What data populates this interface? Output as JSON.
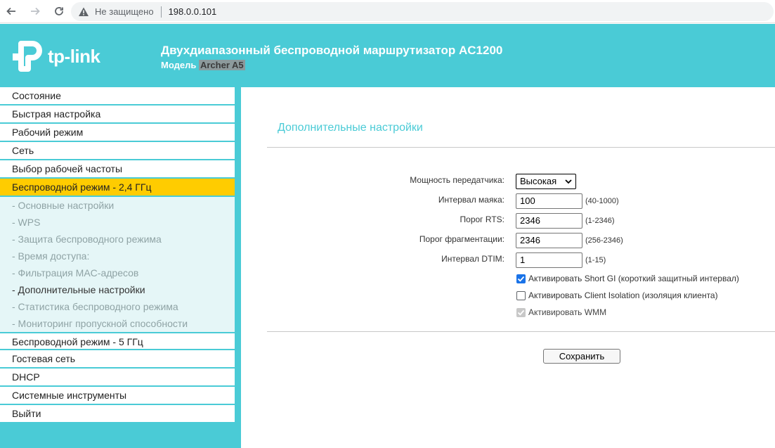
{
  "browser": {
    "security_label": "Не защищено",
    "url": "198.0.0.101"
  },
  "header": {
    "logo_text": "tp-link",
    "title": "Двухдиапазонный беспроводной маршрутизатор AC1200",
    "model_label": "Модель",
    "model_value": "Archer A5"
  },
  "menu": {
    "items_top": [
      {
        "label": "Состояние"
      },
      {
        "label": "Быстрая настройка"
      },
      {
        "label": "Рабочий режим"
      },
      {
        "label": "Сеть"
      },
      {
        "label": "Выбор рабочей частоты"
      },
      {
        "label": "Беспроводной режим - 2,4 ГГц",
        "active": true
      }
    ],
    "sub_items": [
      {
        "label": "- Основные настройки"
      },
      {
        "label": "- WPS"
      },
      {
        "label": "- Защита беспроводного режима"
      },
      {
        "label": "- Время доступа:"
      },
      {
        "label": "- Фильтрация MAC-адресов"
      },
      {
        "label": "- Дополнительные настройки",
        "current": true
      },
      {
        "label": "- Статистика беспроводного режима"
      },
      {
        "label": "- Мониторинг пропускной способности"
      }
    ],
    "items_bottom": [
      {
        "label": "Беспроводной режим - 5 ГГц"
      },
      {
        "label": "Гостевая сеть"
      },
      {
        "label": "DHCP"
      },
      {
        "label": "Системные инструменты"
      },
      {
        "label": "Выйти"
      }
    ]
  },
  "content": {
    "title": "Дополнительные настройки",
    "tx_power": {
      "label": "Мощность передатчика:",
      "value": "Высокая"
    },
    "beacon": {
      "label": "Интервал маяка:",
      "value": "100",
      "hint": "(40-1000)"
    },
    "rts": {
      "label": "Порог RTS:",
      "value": "2346",
      "hint": "(1-2346)"
    },
    "frag": {
      "label": "Порог фрагментации:",
      "value": "2346",
      "hint": "(256-2346)"
    },
    "dtim": {
      "label": "Интервал DTIM:",
      "value": "1",
      "hint": "(1-15)"
    },
    "short_gi": {
      "label": "Активировать Short GI (короткий защитный интервал)",
      "checked": true
    },
    "client_isolation": {
      "label": "Активировать Client Isolation (изоляция клиента)",
      "checked": false
    },
    "wmm": {
      "label": "Активировать WMM",
      "checked": true,
      "disabled": true
    },
    "save_label": "Сохранить"
  },
  "colors": {
    "brand": "#4acbd6",
    "active_menu": "#ffcc00",
    "submenu_bg": "#e5f6f7",
    "checkbox_on": "#1a73e8"
  },
  "icons": {
    "back": "arrow-left-icon",
    "forward": "arrow-right-icon",
    "reload": "reload-icon",
    "warning": "warning-triangle-icon",
    "dropdown": "chevron-down-icon",
    "check": "check-icon"
  }
}
